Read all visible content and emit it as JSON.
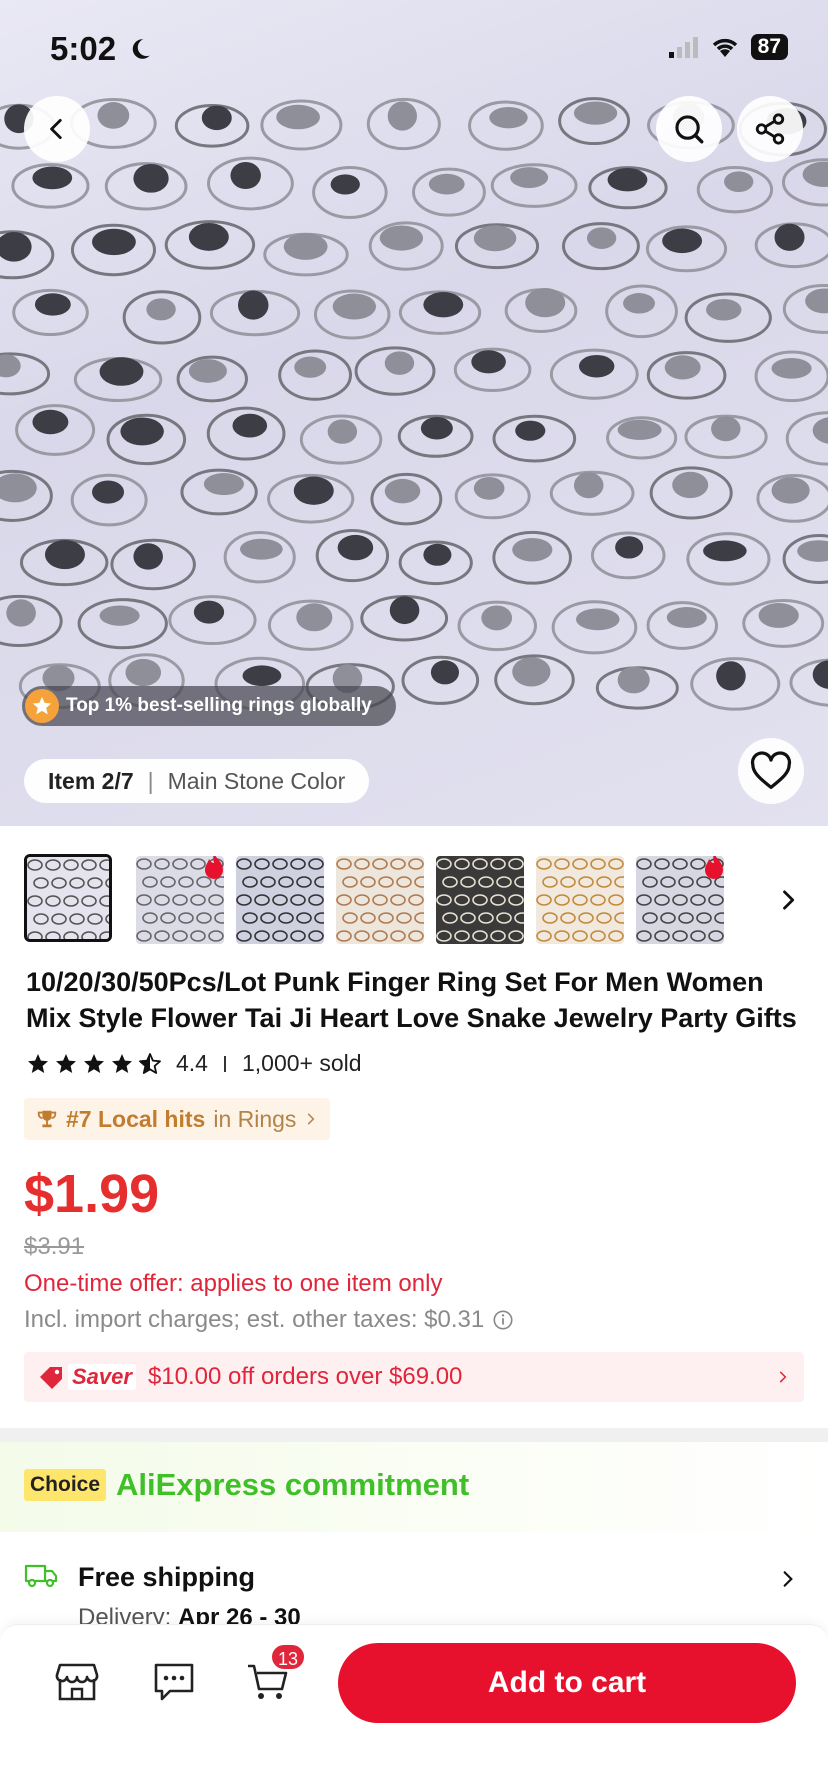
{
  "status_bar": {
    "time": "5:02",
    "battery": "87"
  },
  "gallery": {
    "badge": "Top 1% best-selling rings globally",
    "item_counter": "Item 2/7",
    "variant_label": "Main Stone Color"
  },
  "product": {
    "title": "10/20/30/50Pcs/Lot Punk Finger Ring Set For Men Women Mix Style Flower Tai Ji Heart Love Snake Jewelry Party Gifts",
    "rating": "4.4",
    "sold": "1,000+ sold",
    "rating_value": 4.4,
    "rank_number": "#7 Local hits",
    "rank_category": "in Rings",
    "price": "$1.99",
    "original_price": "$3.91",
    "offer_text": "One-time offer: applies to one item only",
    "taxes_text": "Incl. import charges; est. other taxes: $0.31"
  },
  "saver": {
    "logo": "Saver",
    "text": "$10.00 off orders over $69.00"
  },
  "commitment": {
    "tag": "Choice",
    "title": "AliExpress commitment"
  },
  "shipping": {
    "title": "Free shipping",
    "delivery_label": "Delivery:",
    "delivery_dates": "Apr 26 - 30"
  },
  "bottom_bar": {
    "cart_count": "13",
    "add_to_cart": "Add to cart"
  },
  "colors": {
    "accent_red": "#e8112d",
    "price_red": "#e62e2e",
    "choice_green": "#3fbf28",
    "choice_yellow": "#fde66b"
  }
}
